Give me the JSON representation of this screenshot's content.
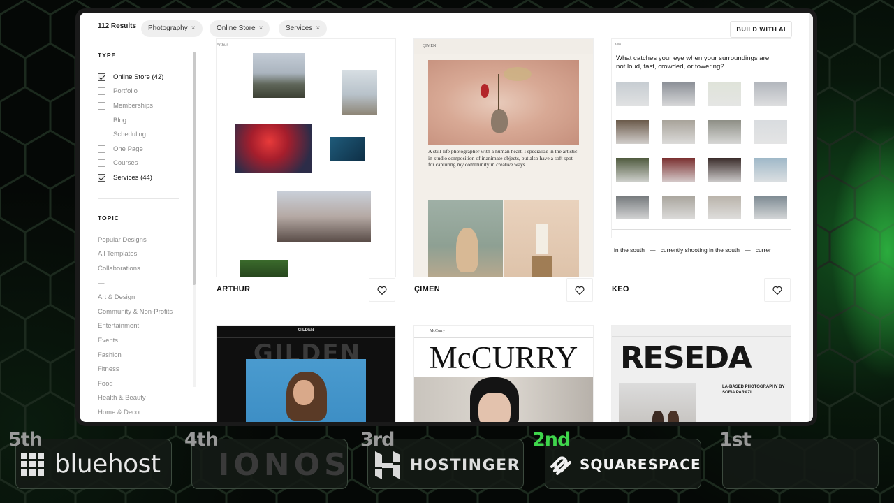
{
  "toolbar": {
    "result_count": "112 Results",
    "filters": [
      "Photography",
      "Online Store",
      "Services"
    ],
    "remove_glyph": "×",
    "build_label": "BUILD WITH AI"
  },
  "sidebar": {
    "type_heading": "TYPE",
    "type_items": [
      {
        "label": "Online Store (42)",
        "checked": true
      },
      {
        "label": "Portfolio",
        "checked": false
      },
      {
        "label": "Memberships",
        "checked": false
      },
      {
        "label": "Blog",
        "checked": false
      },
      {
        "label": "Scheduling",
        "checked": false
      },
      {
        "label": "One Page",
        "checked": false
      },
      {
        "label": "Courses",
        "checked": false
      },
      {
        "label": "Services (44)",
        "checked": true
      }
    ],
    "topic_heading": "TOPIC",
    "topic_items": [
      "Popular Designs",
      "All Templates",
      "Collaborations",
      "—",
      "Art & Design",
      "Community & Non-Profits",
      "Entertainment",
      "Events",
      "Fashion",
      "Fitness",
      "Food",
      "Health & Beauty",
      "Home & Decor"
    ]
  },
  "templates": [
    {
      "name": "ARTHUR",
      "site_label": "Arthur"
    },
    {
      "name": "ÇIMEN",
      "site_label": "ÇIMEN",
      "tagline": "A still-life photographer with a human heart. I specialize in the artistic in-studio composition of inanimate objects, but also have a soft spot for capturing my community in creative ways."
    },
    {
      "name": "KEO",
      "site_label": "Keo",
      "headline": "What catches your eye when your surroundings are not loud, fast, crowded, or towering?",
      "ticker": "in the south   —   currently shooting in the south   —   currer"
    },
    {
      "name": "GILDEN",
      "hero_word": "GILDEN"
    },
    {
      "name": "McCURRY",
      "site_label": "McCurry",
      "hero_word": "McCURRY"
    },
    {
      "name": "RESEDA",
      "hero_word": "RESEDA",
      "subline": "LA-BASED PHOTOGRAPHY BY SOFIA PARAZI"
    }
  ],
  "ranking": [
    {
      "place": "5th",
      "brand": "bluehost",
      "place_color": "#9a9a9a"
    },
    {
      "place": "4th",
      "brand": "IONOS",
      "place_color": "#9a9a9a"
    },
    {
      "place": "3rd",
      "brand": "HOSTINGER",
      "place_color": "#9a9a9a"
    },
    {
      "place": "2nd",
      "brand": "SQUARESPACE",
      "place_color": "#3fd64c"
    },
    {
      "place": "1st",
      "brand": "",
      "place_color": "#9a9a9a"
    }
  ]
}
